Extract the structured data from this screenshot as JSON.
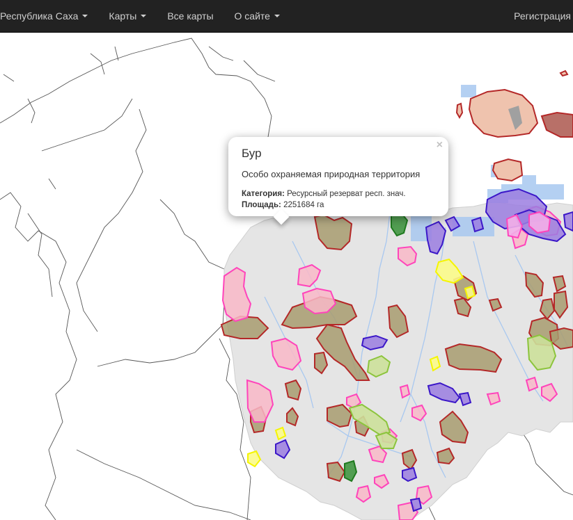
{
  "navbar": {
    "items": [
      {
        "label": "Республика Саха",
        "has_dropdown": true
      },
      {
        "label": "Карты",
        "has_dropdown": true
      },
      {
        "label": "Все карты",
        "has_dropdown": false
      },
      {
        "label": "О сайте",
        "has_dropdown": true
      }
    ],
    "right_label": "Регистрация",
    "background": "#222222"
  },
  "popup": {
    "title": "Бур",
    "subtitle": "Особо охраняемая природная территория",
    "category_label": "Категория:",
    "category_value": "Ресурсный резерват респ. знач.",
    "area_label": "Площадь:",
    "area_value": "2251684 га",
    "close_symbol": "×"
  },
  "map": {
    "region_fill": "#e5e5e5",
    "water_color": "#a8c8f0",
    "category_colors": {
      "resource_reserve": {
        "stroke": "#b42828",
        "fill": "#a89c70"
      },
      "pink": {
        "stroke": "#ff44bb",
        "fill": "#f9b8c8"
      },
      "purple": {
        "stroke": "#3b17c8",
        "fill": "#9b7ee0"
      },
      "yellow": {
        "stroke": "#f5f500",
        "fill": "#fbfb8a"
      },
      "lightgreen": {
        "stroke": "#8cc43c",
        "fill": "#cce09a"
      },
      "darkgreen": {
        "stroke": "#1f7a1f",
        "fill": "#4a9a4a"
      }
    }
  }
}
